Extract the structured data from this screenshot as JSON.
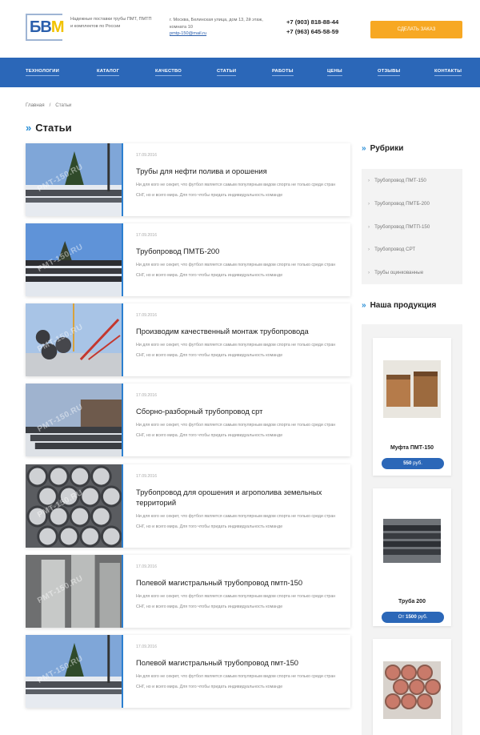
{
  "header": {
    "logo_text_main": "БВ",
    "logo_text_accent": "М",
    "tagline": "Надежные поставки трубы ПМТ, ПМТП и комплектов по России",
    "address": "г. Москва, Белинская улица, дом 13, 2й этаж, комната 10",
    "email": "pmtp-150@mail.ru",
    "phone1": "+7 (903) 818-88-44",
    "phone2": "+7 (963) 645-58-59",
    "order_button": "Сделать заказ"
  },
  "nav": {
    "items": [
      "Технологии",
      "Каталог",
      "Качество",
      "Статьи",
      "Работы",
      "Цены",
      "Отзывы",
      "Контакты"
    ]
  },
  "breadcrumb": {
    "home": "Главная",
    "separator": "/",
    "current": "Статьи"
  },
  "page_title": "Статьи",
  "watermark": "PMT-150.RU",
  "articles": [
    {
      "date": "17.09.2016",
      "title": "Трубы для нефти полива и орошения",
      "text": "Ни для кого не секрет, что футбол является самым популярным видом спорта не только среди стран СНГ, но и всего мира. Для того чтобы придать индивидуальность команде"
    },
    {
      "date": "17.09.2016",
      "title": "Трубопровод ПМТБ-200",
      "text": "Ни для кого не секрет, что футбол является самым популярным видом спорта не только среди стран СНГ, но и всего мира. Для того чтобы придать индивидуальность команде"
    },
    {
      "date": "17.09.2016",
      "title": "Производим качественный монтаж трубопровода",
      "text": "Ни для кого не секрет, что футбол является самым популярным видом спорта не только среди стран СНГ, но и всего мира. Для того чтобы придать индивидуальность команде"
    },
    {
      "date": "17.09.2016",
      "title": "Сборно-разборный трубопровод срт",
      "text": "Ни для кого не секрет, что футбол является самым популярным видом спорта не только среди стран СНГ, но и всего мира. Для того чтобы придать индивидуальность команде"
    },
    {
      "date": "17.09.2016",
      "title": "Трубопровод для орошения и агрополива земельных территорий",
      "text": "Ни для кого не секрет, что футбол является самым популярным видом спорта не только среди стран СНГ, но и всего мира. Для того чтобы придать индивидуальность команде"
    },
    {
      "date": "17.09.2016",
      "title": "Полевой магистральный трубопровод пмтп-150",
      "text": "Ни для кого не секрет, что футбол является самым популярным видом спорта не только среди стран СНГ, но и всего мира. Для того чтобы придать индивидуальность команде"
    },
    {
      "date": "17.09.2016",
      "title": "Полевой магистральный трубопровод пмт-150",
      "text": "Ни для кого не секрет, что футбол является самым популярным видом спорта не только среди стран СНГ, но и всего мира. Для того чтобы придать индивидуальность команде"
    }
  ],
  "sidebar": {
    "rubrics_title": "Рубрики",
    "rubrics": [
      "Трубопровод ПМТ-150",
      "Трубопровод ПМТБ-200",
      "Трубопровод ПМТП-150",
      "Трубопровод СРТ",
      "Трубы оцинкованные"
    ],
    "products_title": "Наша продукция",
    "products": [
      {
        "name": "Муфта ПМТ-150",
        "price_prefix": "",
        "price": "550",
        "currency": "руб."
      },
      {
        "name": "Труба 200",
        "price_prefix": "От",
        "price": "1500",
        "currency": "руб."
      },
      {
        "name": "",
        "price_prefix": "",
        "price": "",
        "currency": ""
      }
    ]
  },
  "colors": {
    "accent_blue": "#2b67b8",
    "order_orange": "#f7a823",
    "chevron": "#2b8fd6"
  }
}
